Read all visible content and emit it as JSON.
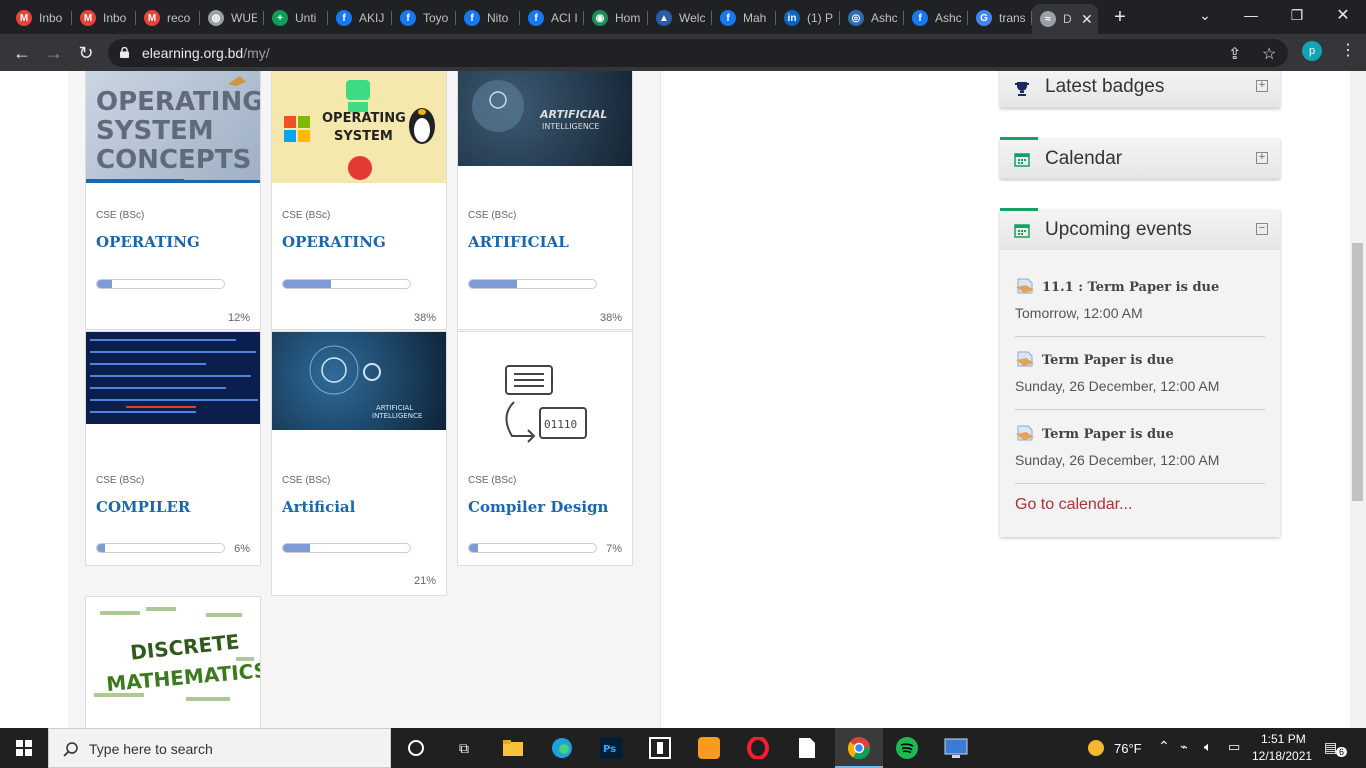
{
  "browser": {
    "tabs": [
      {
        "label": "Inbo",
        "icon": "gmail-icon",
        "color": "#ea4335",
        "glyph": "M"
      },
      {
        "label": "Inbo",
        "icon": "gmail-icon",
        "color": "#ea4335",
        "glyph": "M"
      },
      {
        "label": "reco",
        "icon": "gmail-icon",
        "color": "#ea4335",
        "glyph": "M"
      },
      {
        "label": "WUE",
        "icon": "globe-icon",
        "color": "#9aa0a6",
        "glyph": "◍"
      },
      {
        "label": "Unti",
        "icon": "sheets-icon",
        "color": "#0f9d58",
        "glyph": "+"
      },
      {
        "label": "AKIJ",
        "icon": "facebook-icon",
        "color": "#1877f2",
        "glyph": "f"
      },
      {
        "label": "Toyo",
        "icon": "facebook-icon",
        "color": "#1877f2",
        "glyph": "f"
      },
      {
        "label": "Nito",
        "icon": "facebook-icon",
        "color": "#1877f2",
        "glyph": "f"
      },
      {
        "label": "ACI I",
        "icon": "facebook-icon",
        "color": "#1877f2",
        "glyph": "f"
      },
      {
        "label": "Hom",
        "icon": "site-icon",
        "color": "#1a8f5a",
        "glyph": "◉"
      },
      {
        "label": "Welc",
        "icon": "site-icon",
        "color": "#2a5aa8",
        "glyph": "▲"
      },
      {
        "label": "Mah",
        "icon": "facebook-icon",
        "color": "#1877f2",
        "glyph": "f"
      },
      {
        "label": "(1) P",
        "icon": "linkedin-icon",
        "color": "#0a66c2",
        "glyph": "in"
      },
      {
        "label": "Ashc",
        "icon": "site-icon",
        "color": "#2d6db5",
        "glyph": "◎"
      },
      {
        "label": "Ashc",
        "icon": "facebook-icon",
        "color": "#1877f2",
        "glyph": "f"
      },
      {
        "label": "trans",
        "icon": "google-icon",
        "color": "#4285f4",
        "glyph": "G"
      },
      {
        "label": "D",
        "icon": "moodle-icon",
        "color": "#9aa0a6",
        "glyph": "≈"
      }
    ],
    "new_tab": "+",
    "url_host": "elearning.org.bd",
    "url_path": "/my/",
    "profile_initial": "p"
  },
  "courses": [
    {
      "category": "CSE (BSc)",
      "title": "OPERATING SYSTEM II - LAB",
      "progress": 12,
      "progress_label": "12%",
      "image": "os-concepts-image"
    },
    {
      "category": "CSE (BSc)",
      "title": "OPERATING SYSTEM - II",
      "progress": 38,
      "progress_label": "38%",
      "image": "operating-system-image"
    },
    {
      "category": "CSE (BSc)",
      "title": "ARTIFICIAL INTELLIGENCE & EXPERT SYSTEM",
      "progress": 38,
      "progress_label": "38%",
      "image": "artificial-intelligence-image"
    },
    {
      "category": "CSE (BSc)",
      "title": "COMPILER DESIGN",
      "progress": 6,
      "progress_label": "6%",
      "image": "code-image"
    },
    {
      "category": "CSE (BSc)",
      "title": "Artificial Intelligence & Expert System",
      "progress": 21,
      "progress_label": "21%",
      "image": "ai-head-image"
    },
    {
      "category": "CSE (BSc)",
      "title": "Compiler Design Lab",
      "progress": 7,
      "progress_label": "7%",
      "image": "compiler-lab-image"
    },
    {
      "image": "discrete-mathematics-image"
    }
  ],
  "images_text": {
    "os_concepts": [
      "OPERATING",
      "SYSTEM",
      "CONCEPTS"
    ],
    "operating_system": [
      "OPERATING",
      "SYSTEM"
    ],
    "ai": [
      "ARTIFICIAL",
      "INTELLIGENCE"
    ],
    "ai2": [
      "ARTIFICIAL",
      "INTELLIGENCE"
    ],
    "binary": "01110",
    "discrete": [
      "DISCRETE",
      "MATHEMATICS"
    ]
  },
  "sidebar": {
    "latest_badges": "Latest badges",
    "calendar": "Calendar",
    "upcoming_events": "Upcoming events",
    "events": [
      {
        "name": "11.1 : Term Paper is due",
        "date": "Tomorrow, 12:00 AM"
      },
      {
        "name": "Term Paper is due",
        "date": "Sunday, 26 December, 12:00 AM"
      },
      {
        "name": "Term Paper is due",
        "date": "Sunday, 26 December, 12:00 AM"
      }
    ],
    "go_to_calendar": "Go to calendar..."
  },
  "taskbar": {
    "search_placeholder": "Type here to search",
    "weather": "76°F",
    "time": "1:51 PM",
    "date": "12/18/2021",
    "notifications": "6"
  },
  "colors": {
    "accent_green": "#15a064",
    "link_blue": "#1a67b1",
    "progress": "#7f9bd6"
  }
}
